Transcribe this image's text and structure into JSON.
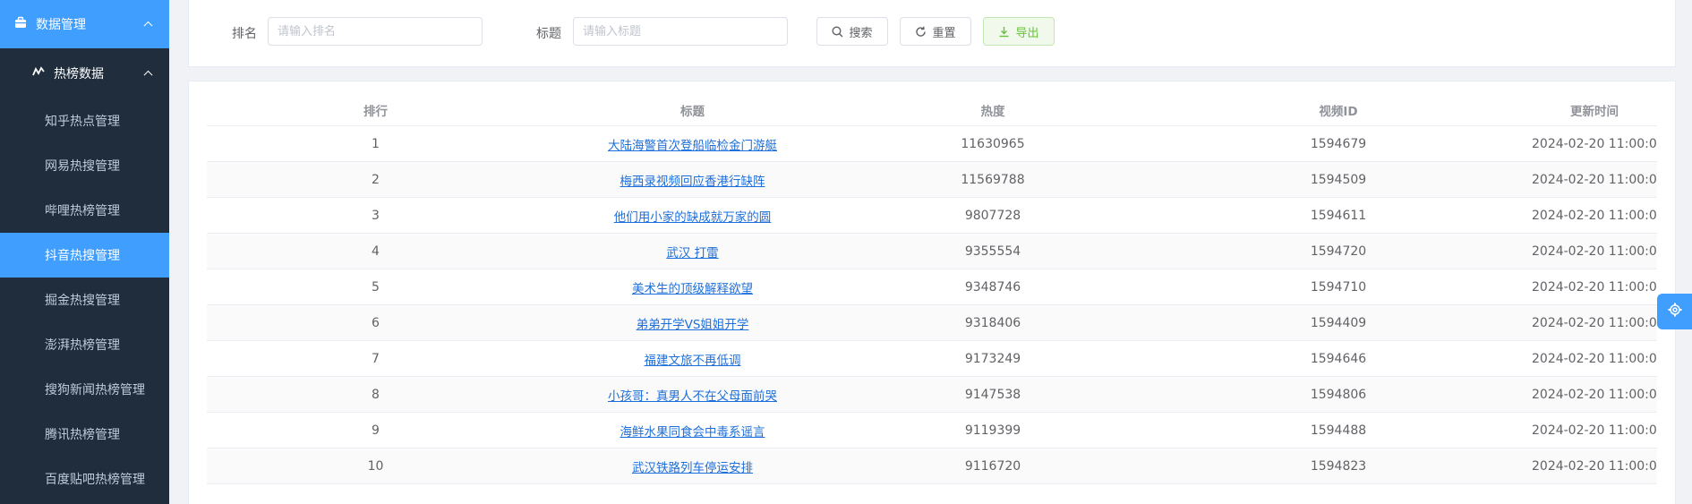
{
  "sidebar": {
    "top": {
      "label": "数据管理",
      "icon": "briefcase-icon"
    },
    "sub": {
      "label": "热榜数据",
      "icon": "chart-icon"
    },
    "items": [
      {
        "label": "知乎热点管理",
        "active": false
      },
      {
        "label": "网易热搜管理",
        "active": false
      },
      {
        "label": "哔哩热榜管理",
        "active": false
      },
      {
        "label": "抖音热搜管理",
        "active": true
      },
      {
        "label": "掘金热搜管理",
        "active": false
      },
      {
        "label": "澎湃热榜管理",
        "active": false
      },
      {
        "label": "搜狗新闻热榜管理",
        "active": false
      },
      {
        "label": "腾讯热榜管理",
        "active": false
      },
      {
        "label": "百度贴吧热榜管理",
        "active": false
      }
    ]
  },
  "search": {
    "rank_label": "排名",
    "rank_placeholder": "请输入排名",
    "title_label": "标题",
    "title_placeholder": "请输入标题",
    "search_button": "搜索",
    "reset_button": "重置",
    "export_button": "导出"
  },
  "table": {
    "headers": [
      "排行",
      "标题",
      "热度",
      "视频ID",
      "更新时间"
    ],
    "rows": [
      {
        "rank": "1",
        "title": "大陆海警首次登船临检金门游艇",
        "heat": "11630965",
        "video_id": "1594679",
        "time": "2024-02-20 11:00:01"
      },
      {
        "rank": "2",
        "title": "梅西录视频回应香港行缺阵",
        "heat": "11569788",
        "video_id": "1594509",
        "time": "2024-02-20 11:00:01"
      },
      {
        "rank": "3",
        "title": "他们用小家的缺成就万家的圆",
        "heat": "9807728",
        "video_id": "1594611",
        "time": "2024-02-20 11:00:01"
      },
      {
        "rank": "4",
        "title": "武汉 打雷",
        "heat": "9355554",
        "video_id": "1594720",
        "time": "2024-02-20 11:00:01"
      },
      {
        "rank": "5",
        "title": "美术生的顶级解释欲望",
        "heat": "9348746",
        "video_id": "1594710",
        "time": "2024-02-20 11:00:01"
      },
      {
        "rank": "6",
        "title": "弟弟开学VS姐姐开学",
        "heat": "9318406",
        "video_id": "1594409",
        "time": "2024-02-20 11:00:01"
      },
      {
        "rank": "7",
        "title": "福建文旅不再低调",
        "heat": "9173249",
        "video_id": "1594646",
        "time": "2024-02-20 11:00:01"
      },
      {
        "rank": "8",
        "title": "小孩哥：真男人不在父母面前哭",
        "heat": "9147538",
        "video_id": "1594806",
        "time": "2024-02-20 11:00:01"
      },
      {
        "rank": "9",
        "title": "海鲜水果同食会中毒系谣言",
        "heat": "9119399",
        "video_id": "1594488",
        "time": "2024-02-20 11:00:01"
      },
      {
        "rank": "10",
        "title": "武汉铁路列车停运安排",
        "heat": "9116720",
        "video_id": "1594823",
        "time": "2024-02-20 11:00:01"
      }
    ]
  },
  "colors": {
    "primary": "#409eff",
    "sidebar_bg": "#1f2d3d",
    "link": "#1e6fd9",
    "success": "#67c23a"
  },
  "settings_icon": "gear-icon"
}
